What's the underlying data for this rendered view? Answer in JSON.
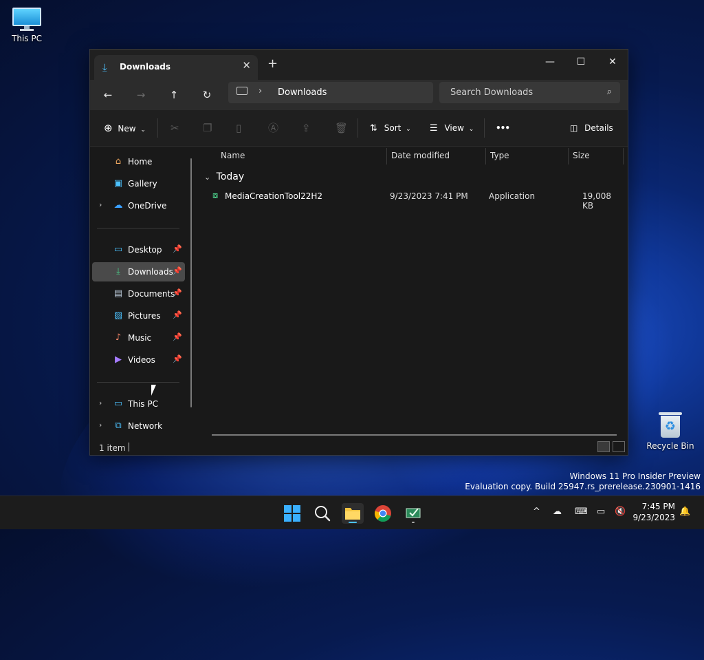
{
  "desktop": {
    "icons": [
      {
        "label": "This PC"
      },
      {
        "label": "Recycle Bin"
      }
    ],
    "watermark": {
      "line1": "Windows 11 Pro Insider Preview",
      "line2": "Evaluation copy. Build 25947.rs_prerelease.230901-1416"
    }
  },
  "window": {
    "tab": {
      "label": "Downloads",
      "close": "✕",
      "icon": "download-icon"
    },
    "new_tab": "+",
    "controls": {
      "minimize": "—",
      "maximize": "☐",
      "close": "✕"
    },
    "nav": {
      "back": "←",
      "forward": "→",
      "up": "↑",
      "refresh": "↻"
    },
    "address": {
      "separator": "›",
      "crumb": "Downloads"
    },
    "search": {
      "placeholder": "Search Downloads",
      "icon": "search-icon"
    },
    "commands": {
      "new_label": "New",
      "sort_label": "Sort",
      "view_label": "View",
      "more_label": "•••",
      "details_label": "Details"
    },
    "sidebar": {
      "items": [
        {
          "label": "Home",
          "icon": "home-icon"
        },
        {
          "label": "Gallery",
          "icon": "gallery-icon"
        },
        {
          "label": "OneDrive",
          "icon": "cloud-icon"
        },
        {
          "label": "Desktop",
          "icon": "desktop-icon"
        },
        {
          "label": "Downloads",
          "icon": "download-icon"
        },
        {
          "label": "Documents",
          "icon": "document-icon"
        },
        {
          "label": "Pictures",
          "icon": "pictures-icon"
        },
        {
          "label": "Music",
          "icon": "music-icon"
        },
        {
          "label": "Videos",
          "icon": "videos-icon"
        },
        {
          "label": "This PC",
          "icon": "computer-icon"
        },
        {
          "label": "Network",
          "icon": "network-icon"
        }
      ]
    },
    "columns": {
      "name": "Name",
      "date": "Date modified",
      "type": "Type",
      "size": "Size"
    },
    "group": {
      "label": "Today"
    },
    "files": [
      {
        "name": "MediaCreationTool22H2",
        "date": "9/23/2023 7:41 PM",
        "type": "Application",
        "size": "19,008 KB"
      }
    ],
    "status": {
      "count": "1 item"
    }
  },
  "taskbar": {
    "apps": [
      "start-icon",
      "search-icon",
      "file-explorer-icon",
      "chrome-icon",
      "media-creation-tool-icon"
    ],
    "tray_chevron": "^",
    "clock": {
      "time": "7:45 PM",
      "date": "9/23/2023"
    }
  },
  "colors": {
    "accent": "#4cc2ff",
    "window_bg": "#191919",
    "taskbar_bg": "#1c1c1c"
  }
}
